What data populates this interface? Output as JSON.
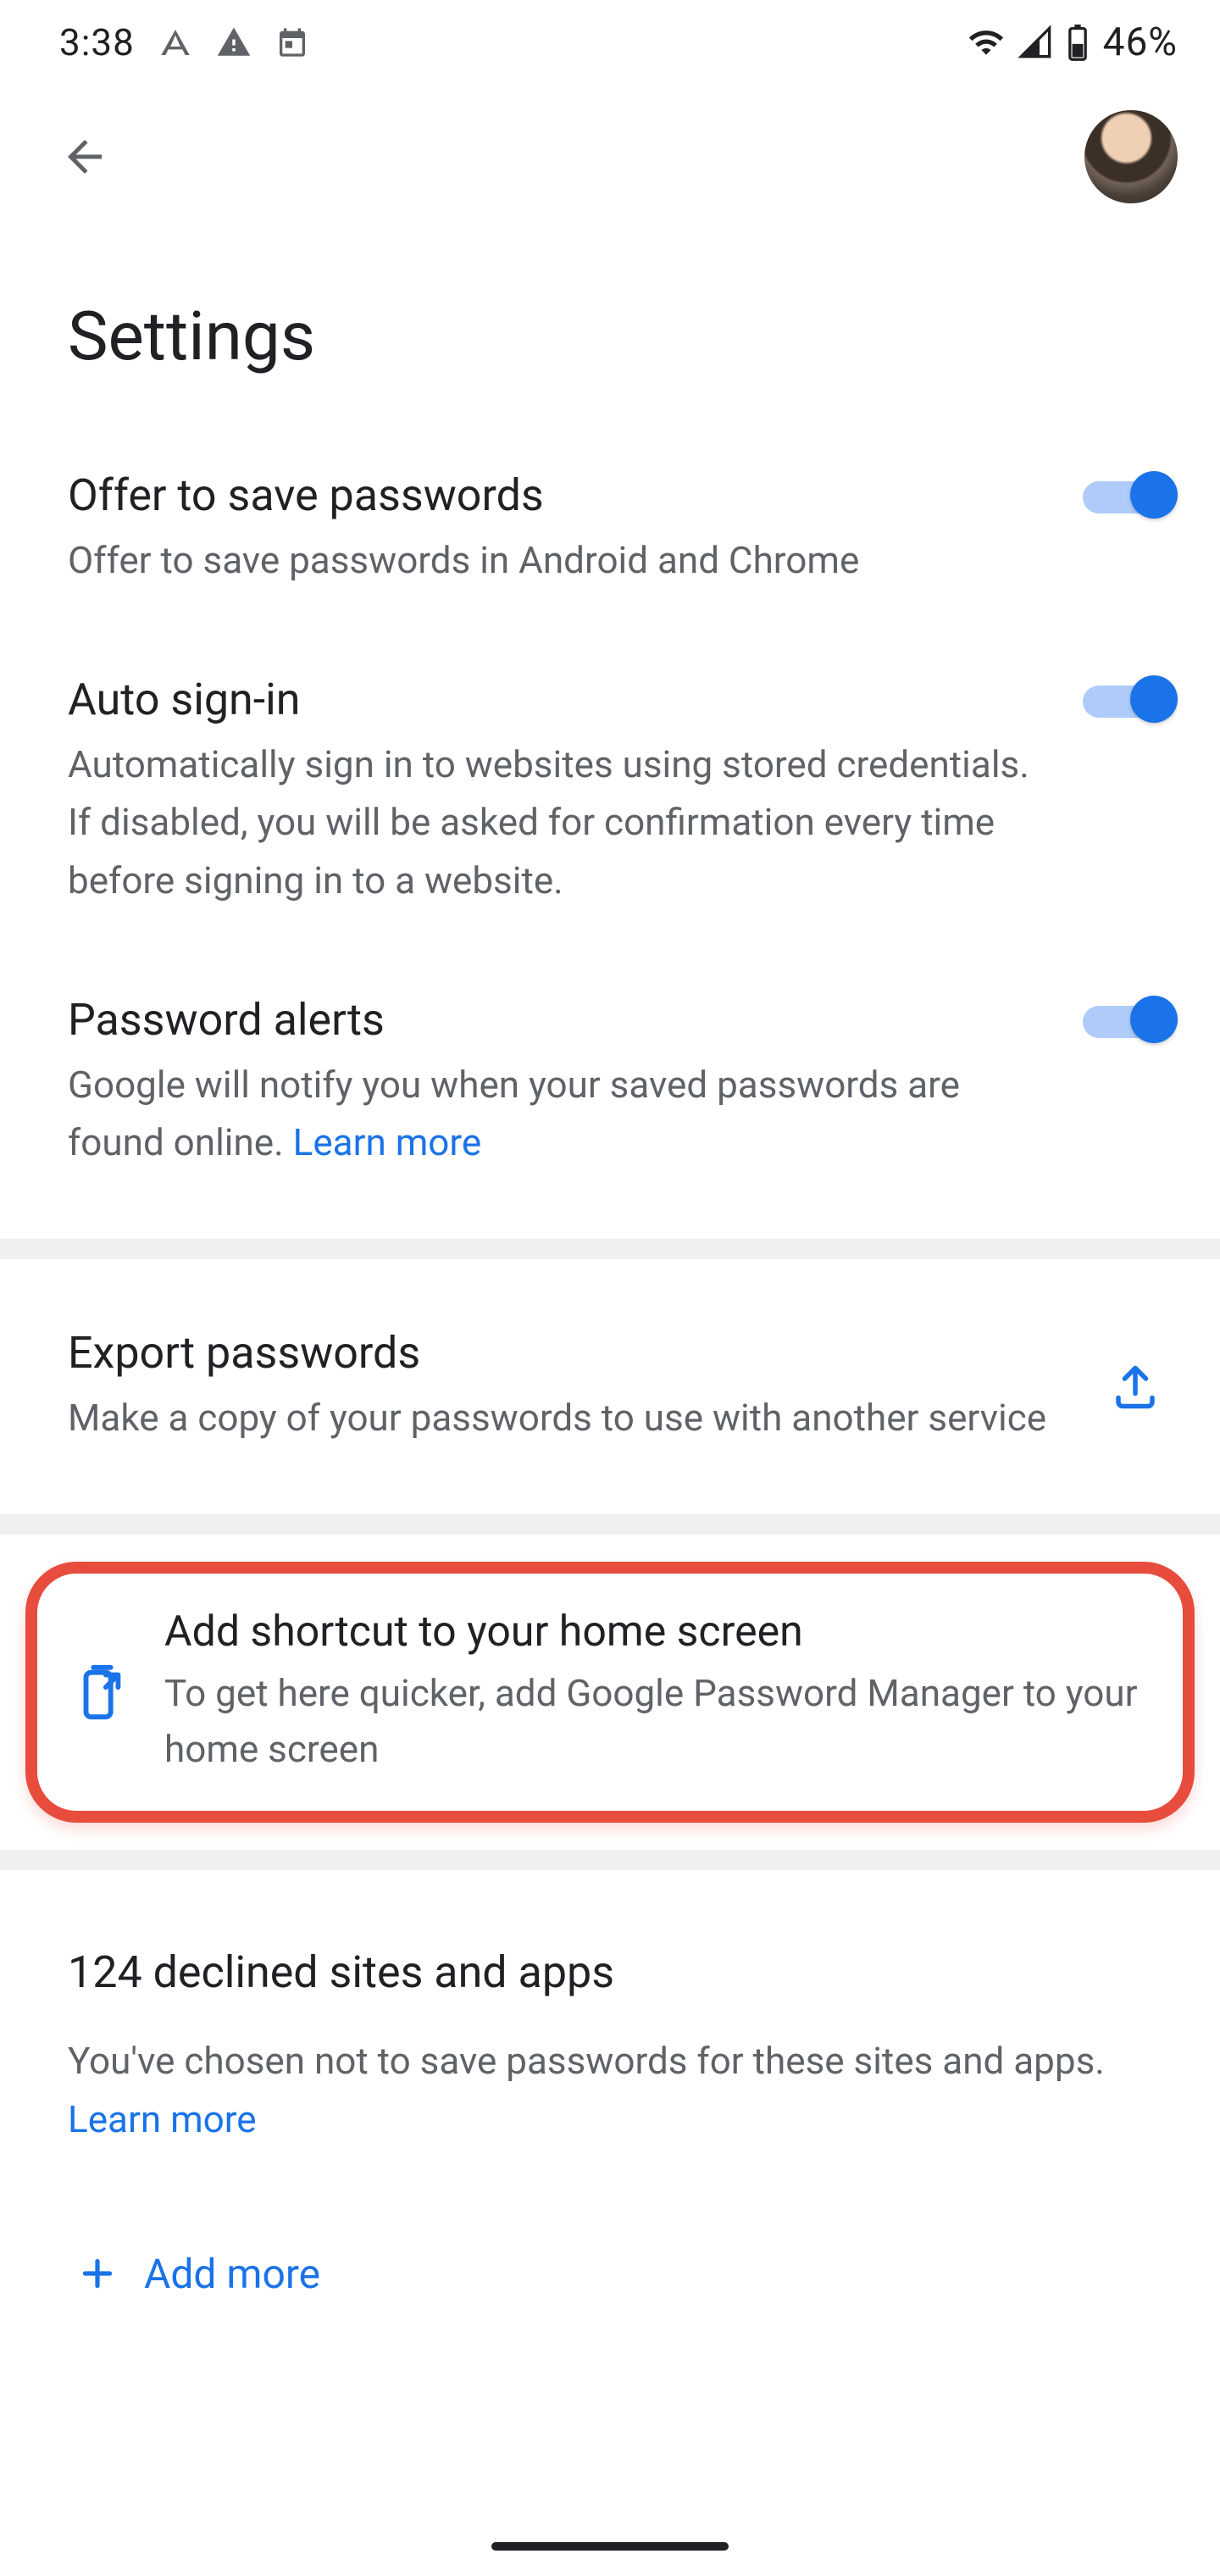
{
  "statusbar": {
    "time": "3:38",
    "battery_pct": "46%"
  },
  "page": {
    "title": "Settings"
  },
  "settings": {
    "offer_save": {
      "title": "Offer to save passwords",
      "desc": "Offer to save passwords in Android and Chrome",
      "enabled": true
    },
    "auto_signin": {
      "title": "Auto sign-in",
      "desc": "Automatically sign in to websites using stored credentials. If disabled, you will be asked for confirmation every time before signing in to a website.",
      "enabled": true
    },
    "password_alerts": {
      "title": "Password alerts",
      "desc": "Google will notify you when your saved passwords are found online. ",
      "learn_more": "Learn more",
      "enabled": true
    }
  },
  "export": {
    "title": "Export passwords",
    "desc": "Make a copy of your passwords to use with another service"
  },
  "shortcut": {
    "title": "Add shortcut to your home screen",
    "desc": "To get here quicker, add Google Password Manager to your home screen"
  },
  "declined": {
    "count": 124,
    "title": "124 declined sites and apps",
    "desc": "You've chosen not to save passwords for these sites and apps. ",
    "learn_more": "Learn more",
    "add_more": "Add more"
  }
}
